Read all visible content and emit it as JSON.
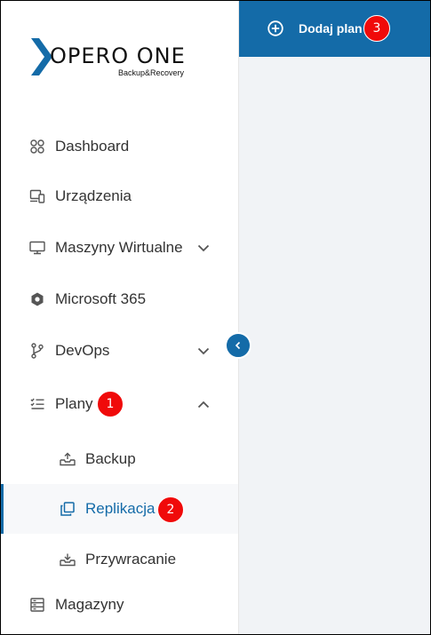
{
  "brand": {
    "name": "XOPERO ONE",
    "name_rest": "OPERO ONE",
    "tagline": "Backup&Recovery",
    "colors": {
      "primary": "#146ba8",
      "badge": "#f00a0a"
    }
  },
  "topbar": {
    "add_plan_label": "Dodaj plan",
    "add_plan_icon": "plus-circle-icon",
    "badge": "3"
  },
  "sidebar": {
    "collapse_icon": "chevron-left-icon",
    "items": [
      {
        "label": "Dashboard",
        "icon": "grid-circles-icon"
      },
      {
        "label": "Urządzenia",
        "icon": "devices-icon"
      },
      {
        "label": "Maszyny Wirtualne",
        "icon": "monitor-icon",
        "chevron": "chevron-down-icon"
      },
      {
        "label": "Microsoft 365",
        "icon": "hexagon-icon"
      },
      {
        "label": "DevOps",
        "icon": "git-branch-icon",
        "chevron": "chevron-down-icon"
      },
      {
        "label": "Plany",
        "icon": "checklist-icon",
        "chevron": "chevron-up-icon",
        "badge": "1",
        "expanded": true
      },
      {
        "label": "Magazyny",
        "icon": "storage-icon"
      }
    ],
    "plan_subitems": [
      {
        "label": "Backup",
        "icon": "upload-tray-icon"
      },
      {
        "label": "Replikacja",
        "icon": "copy-icon",
        "active": true,
        "badge": "2"
      },
      {
        "label": "Przywracanie",
        "icon": "download-tray-icon"
      }
    ]
  }
}
